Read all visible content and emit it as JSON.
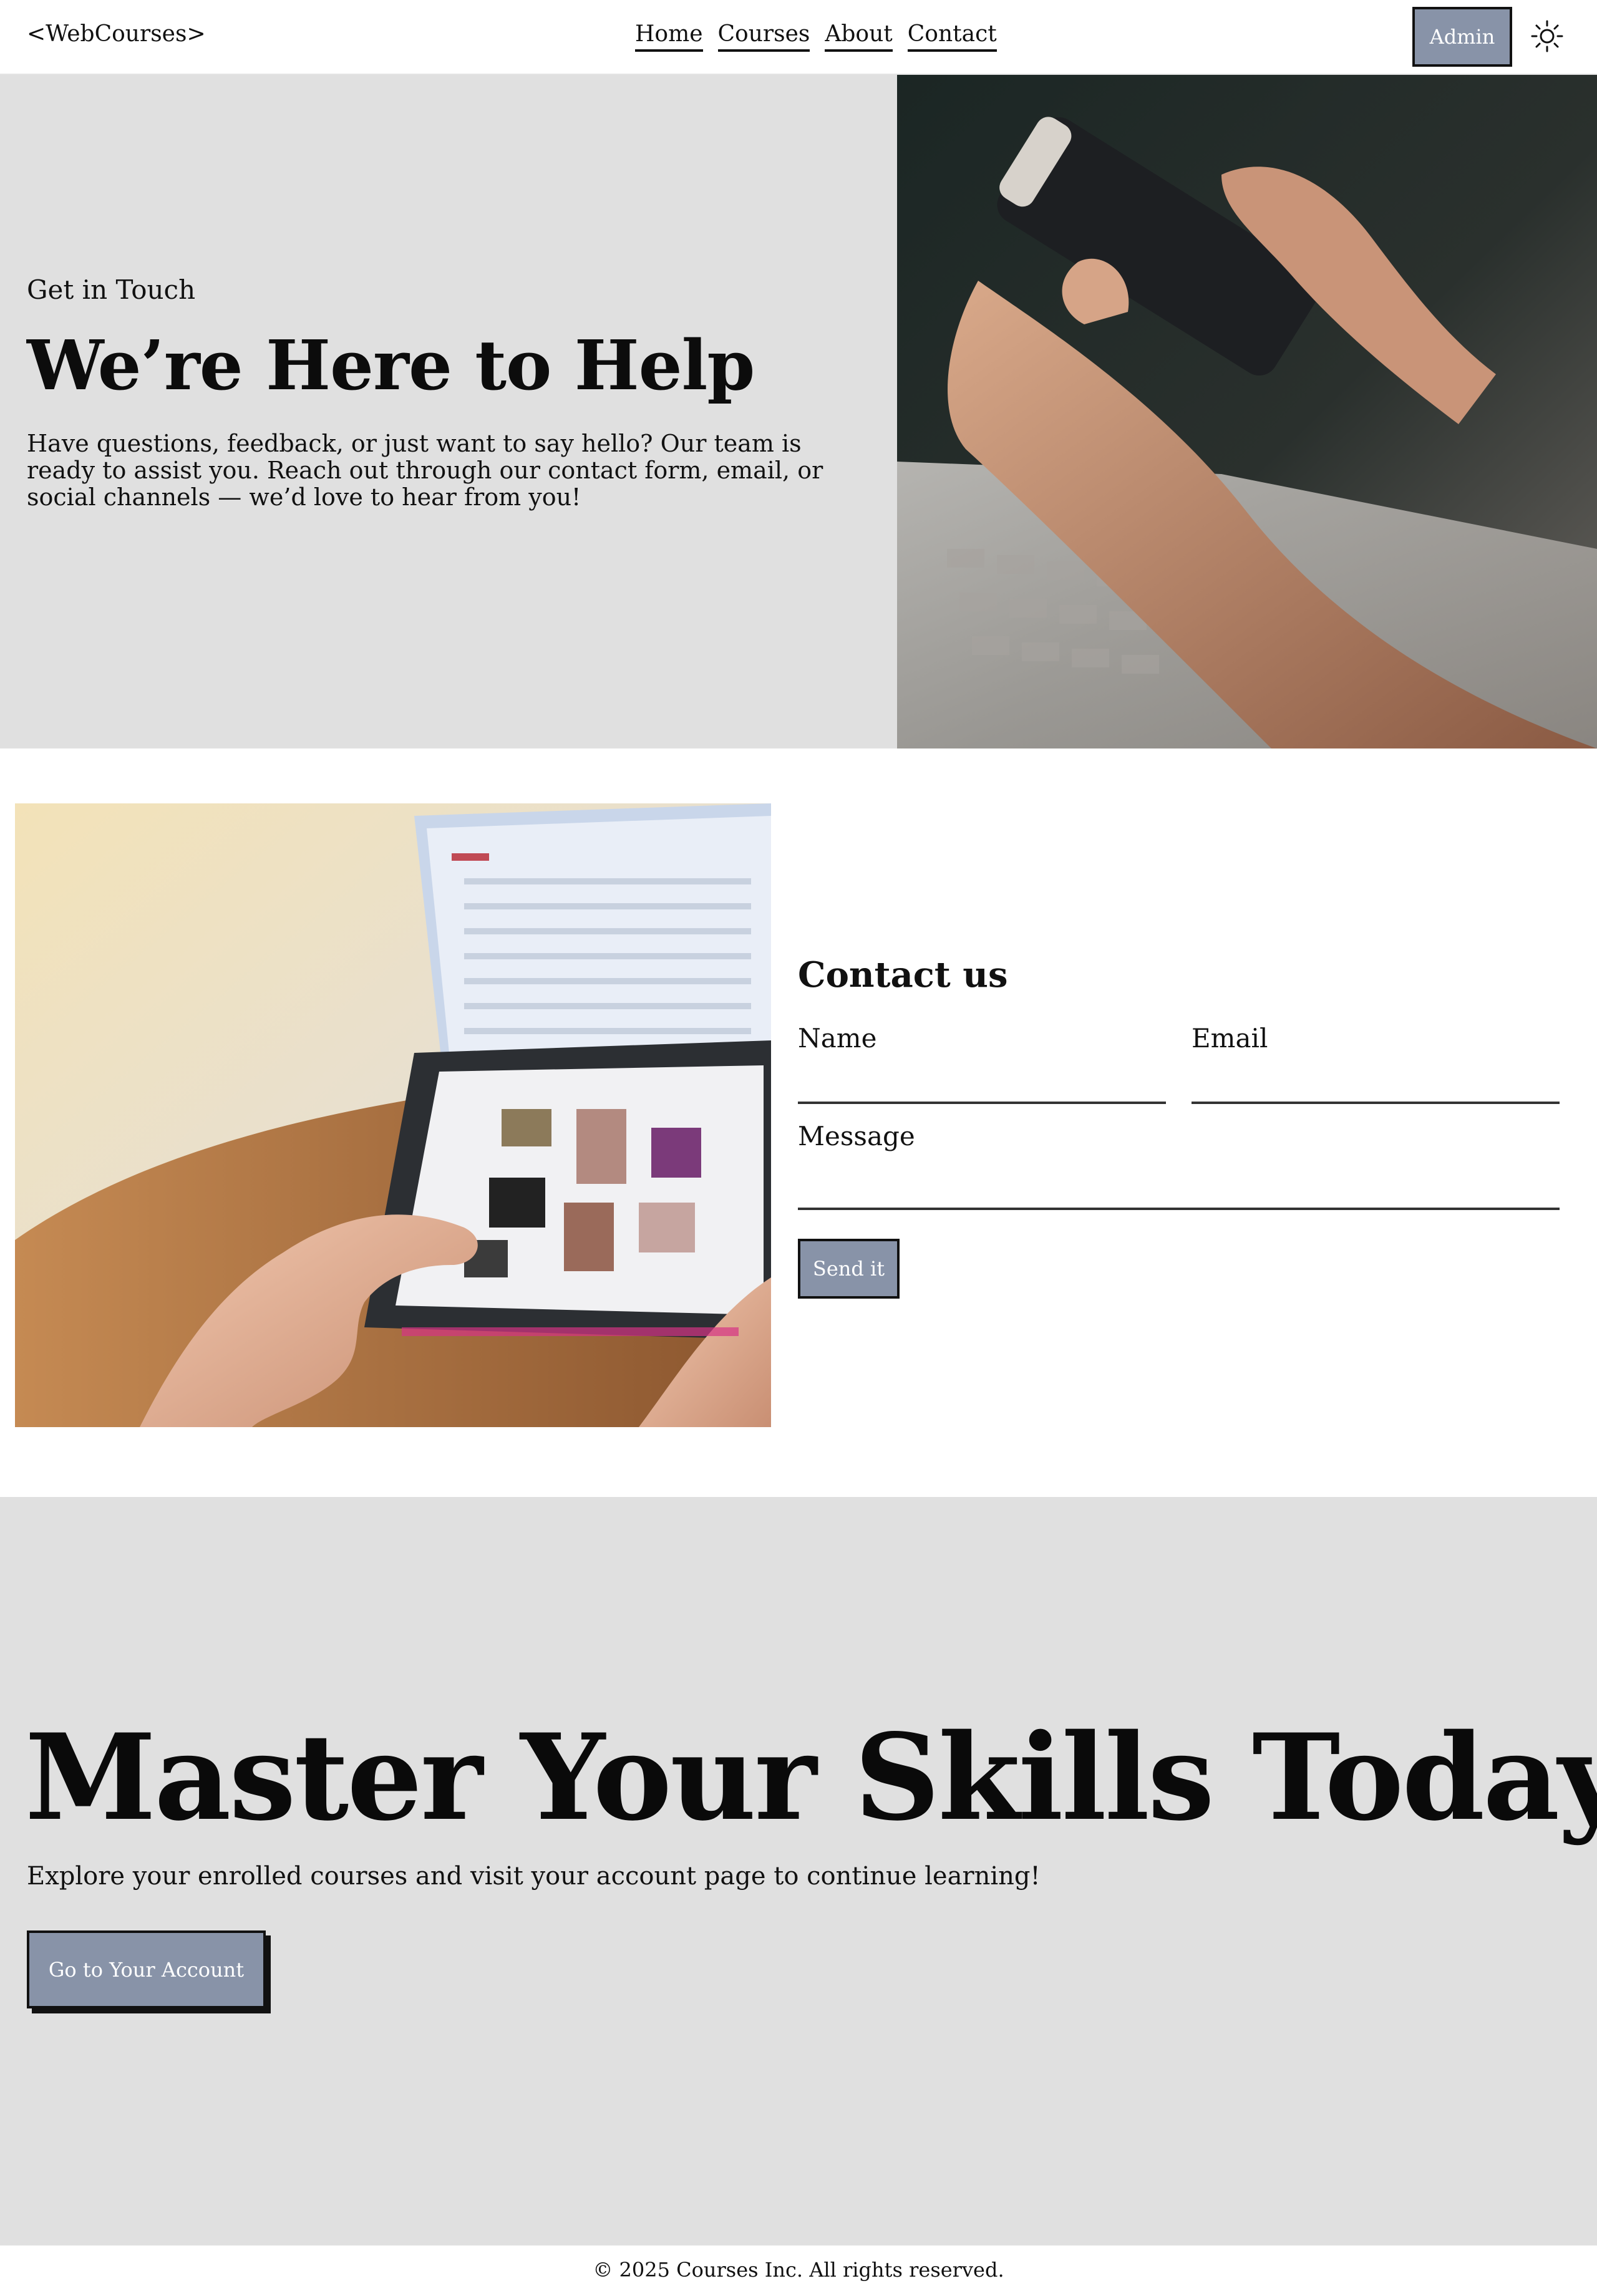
{
  "nav": {
    "logo": "<WebCourses>",
    "links": [
      "Home",
      "Courses",
      "About",
      "Contact"
    ],
    "admin_label": "Admin",
    "theme_icon": "sun-icon"
  },
  "hero": {
    "eyebrow": "Get in Touch",
    "title": "We’re Here to Help",
    "text": "Have questions, feedback, or just want to say hello? Our team is ready to assist you. Reach out through our contact form, email, or social channels — we’d love to hear from you!"
  },
  "contact": {
    "title": "Contact us",
    "name_label": "Name",
    "email_label": "Email",
    "message_label": "Message",
    "send_label": "Send it"
  },
  "cta": {
    "title": "Master Your Skills Today!",
    "text": "Explore your enrolled courses and visit your account page to continue learning!",
    "button_label": "Go to Your Account"
  },
  "footer": {
    "text": "© 2025 Courses Inc. All rights reserved."
  },
  "colors": {
    "button_bg": "#8893a8",
    "section_bg": "#e0e0e0"
  }
}
